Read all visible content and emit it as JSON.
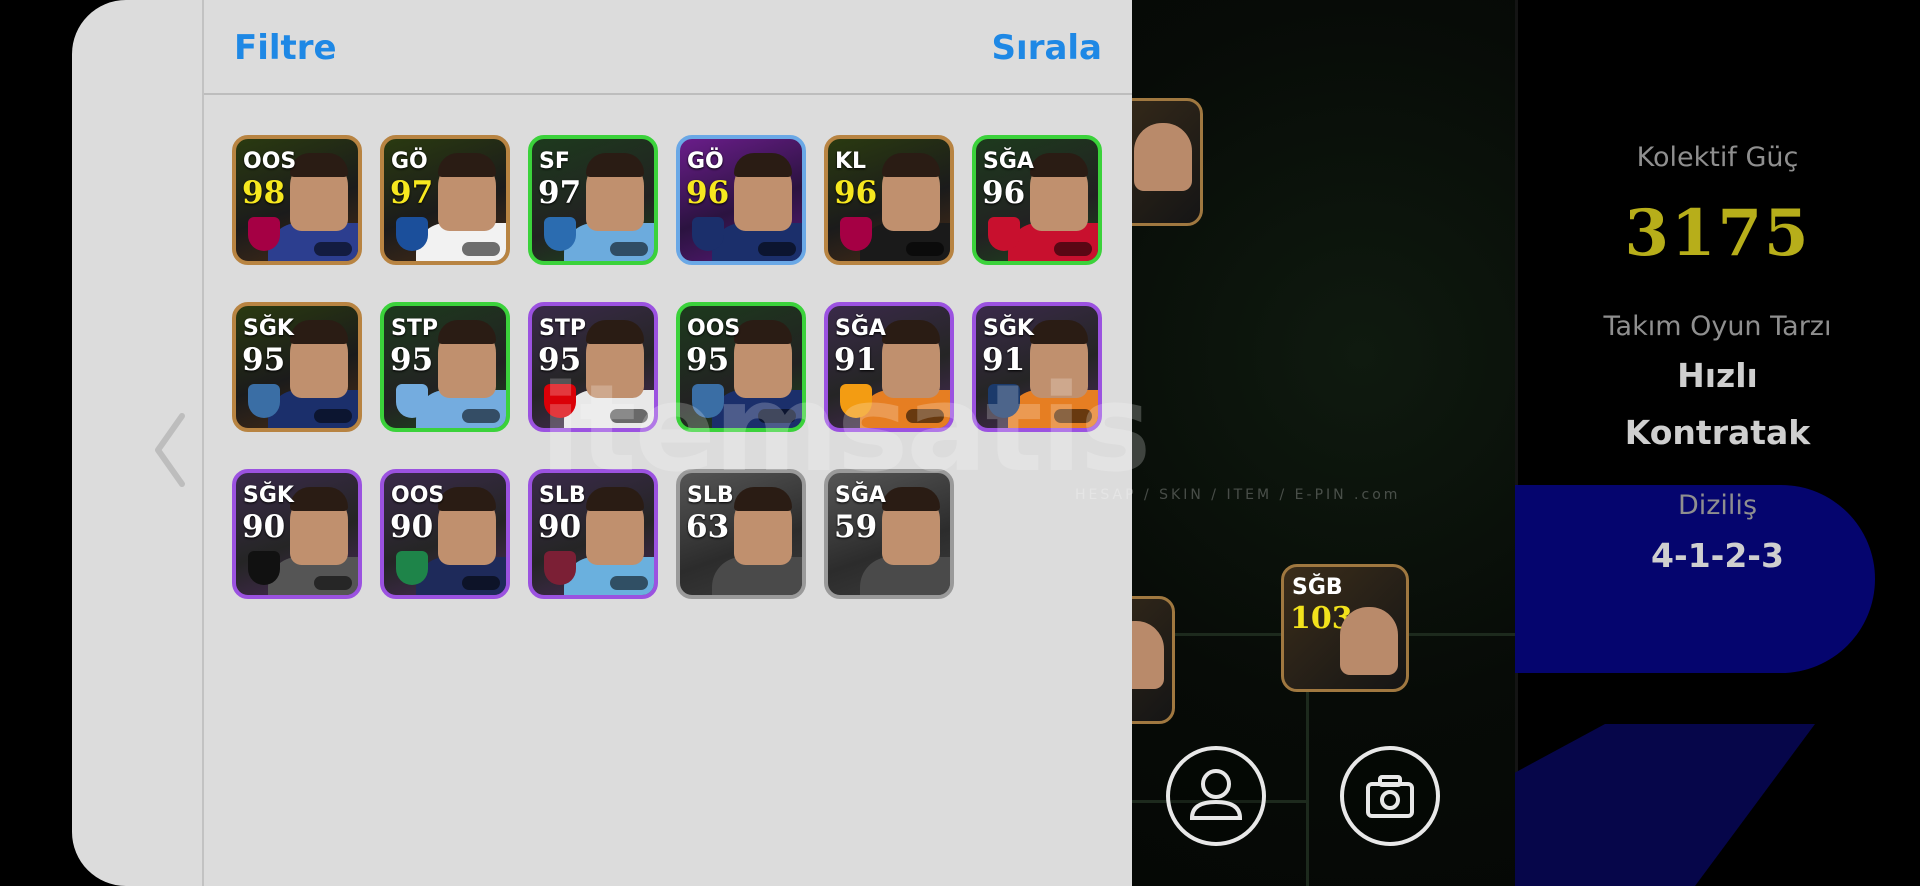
{
  "filter_panel": {
    "filter_label": "Filtre",
    "sort_label": "Sırala",
    "players": [
      {
        "pos": "OOS",
        "rating": "98",
        "rarity": "gold",
        "rating_color": "#f6e81f",
        "crest_color": "#a50044",
        "shirt_color": "#2c3e8f"
      },
      {
        "pos": "GÖ",
        "rating": "97",
        "rarity": "gold",
        "rating_color": "#f6e81f",
        "crest_color": "#1b4f9b",
        "shirt_color": "#f2f2f2"
      },
      {
        "pos": "SF",
        "rating": "97",
        "rarity": "green",
        "rating_color": "#ffffff",
        "crest_color": "#2b6cb0",
        "shirt_color": "#6cabdd"
      },
      {
        "pos": "GÖ",
        "rating": "96",
        "rarity": "blue",
        "rating_color": "#f6e81f",
        "crest_color": "#1b2f6b",
        "shirt_color": "#1b2f6b"
      },
      {
        "pos": "KL",
        "rating": "96",
        "rarity": "gold",
        "rating_color": "#f6e81f",
        "crest_color": "#a50044",
        "shirt_color": "#1a1a1a"
      },
      {
        "pos": "SĞA",
        "rating": "96",
        "rarity": "green",
        "rating_color": "#ffffff",
        "crest_color": "#c8102e",
        "shirt_color": "#c8102e"
      },
      {
        "pos": "SĞK",
        "rating": "95",
        "rarity": "gold",
        "rating_color": "#ffffff",
        "crest_color": "#3a6ea5",
        "shirt_color": "#1b2f6b"
      },
      {
        "pos": "STP",
        "rating": "95",
        "rarity": "green",
        "rating_color": "#ffffff",
        "crest_color": "#74acdf",
        "shirt_color": "#74acdf"
      },
      {
        "pos": "STP",
        "rating": "95",
        "rarity": "purple",
        "rating_color": "#ffffff",
        "crest_color": "#db0007",
        "shirt_color": "#e8e8e8"
      },
      {
        "pos": "OOS",
        "rating": "95",
        "rarity": "green",
        "rating_color": "#ffffff",
        "crest_color": "#3a6ea5",
        "shirt_color": "#1b2f6b"
      },
      {
        "pos": "SĞA",
        "rating": "91",
        "rarity": "purple",
        "rating_color": "#ffffff",
        "crest_color": "#f39c12",
        "shirt_color": "#e67e22"
      },
      {
        "pos": "SĞK",
        "rating": "91",
        "rarity": "purple",
        "rating_color": "#ffffff",
        "crest_color": "#1b3a6b",
        "shirt_color": "#e67e22"
      },
      {
        "pos": "SĞK",
        "rating": "90",
        "rarity": "purple",
        "rating_color": "#ffffff",
        "crest_color": "#111111",
        "shirt_color": "#555555"
      },
      {
        "pos": "OOS",
        "rating": "90",
        "rarity": "purple",
        "rating_color": "#ffffff",
        "crest_color": "#1e8449",
        "shirt_color": "#1e2a5a"
      },
      {
        "pos": "SLB",
        "rating": "90",
        "rarity": "purple",
        "rating_color": "#ffffff",
        "crest_color": "#7b1f35",
        "shirt_color": "#6ab0de"
      },
      {
        "pos": "SLB",
        "rating": "63",
        "rarity": "grey",
        "rating_color": "#ffffff",
        "crest_color": "",
        "shirt_color": "#4a4a4a"
      },
      {
        "pos": "SĞA",
        "rating": "59",
        "rarity": "grey",
        "rating_color": "#ffffff",
        "crest_color": "",
        "shirt_color": "#4a4a4a"
      }
    ]
  },
  "team_stats": {
    "collective_label": "Kolektif Güç",
    "collective_value": "3175",
    "playstyle_label": "Takım Oyun Tarzı",
    "playstyle_line1": "Hızlı",
    "playstyle_line2": "Kontratak",
    "formation_label": "Diziliş",
    "formation_value": "4-1-2-3"
  },
  "pitch": {
    "featured_player": {
      "pos": "SĞB",
      "rating": "103"
    }
  },
  "watermark": {
    "text": "itemsatis",
    "sub": "HESAP / SKIN / ITEM / E-PIN .com"
  },
  "icons": {
    "back": "chevron-left-icon",
    "profile": "user-icon",
    "screenshot": "camera-icon"
  }
}
